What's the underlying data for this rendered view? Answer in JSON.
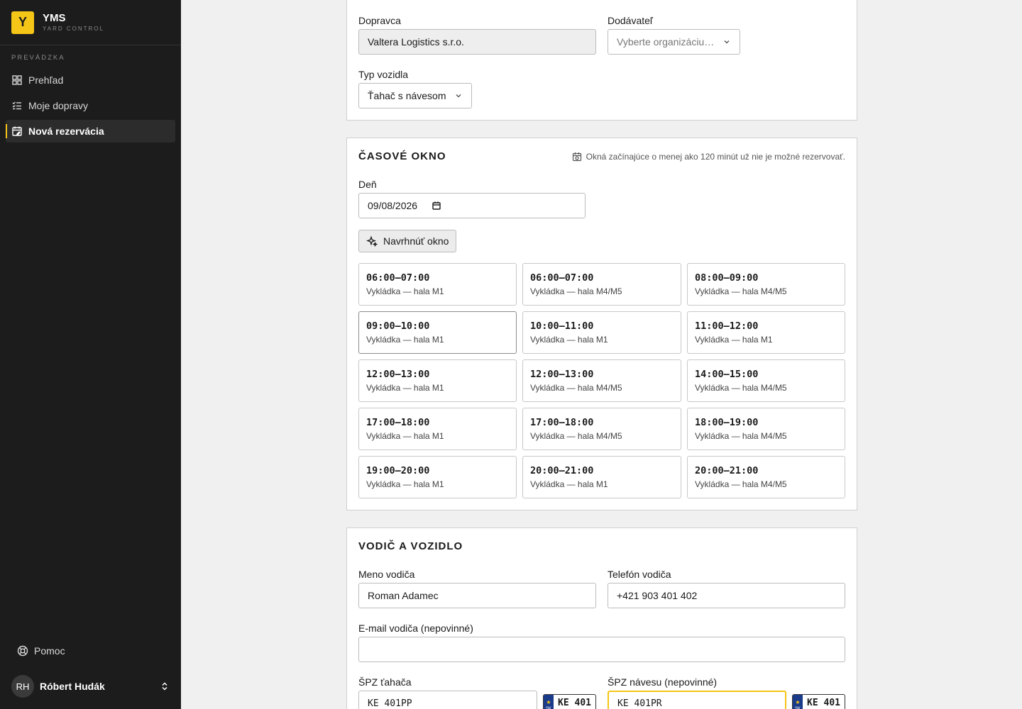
{
  "brand": {
    "logo_letter": "Y",
    "name": "YMS",
    "subtitle": "YARD CONTROL",
    "accent": "#f5c518"
  },
  "sidebar": {
    "section": "PREVÁDZKA",
    "items": [
      {
        "label": "Prehľad",
        "icon": "grid-icon"
      },
      {
        "label": "Moje dopravy",
        "icon": "list-check-icon"
      },
      {
        "label": "Nová rezervácia",
        "icon": "calendar-edit-icon",
        "active": true
      }
    ],
    "help": "Pomoc",
    "user": {
      "initials": "RH",
      "name": "Róbert Hudák"
    }
  },
  "carrier_card": {
    "carrier_label": "Dopravca",
    "carrier_value": "Valtera Logistics s.r.o.",
    "supplier_label": "Dodávateľ",
    "supplier_placeholder": "Vyberte organizáciu…",
    "vehicle_type_label": "Typ vozidla",
    "vehicle_type_value": "Ťahač s návesom"
  },
  "time_card": {
    "title": "Časové okno",
    "hint": "Okná začínajúce o menej ako 120 minút už nie je možné rezervovať.",
    "day_label": "Deň",
    "day_value": "09/08/2026",
    "suggest_button": "Navrhnúť okno",
    "slots": [
      {
        "time": "06:00–07:00",
        "sub": "Vykládka — hala M1"
      },
      {
        "time": "06:00–07:00",
        "sub": "Vykládka — hala M4/M5"
      },
      {
        "time": "08:00–09:00",
        "sub": "Vykládka — hala M4/M5"
      },
      {
        "time": "09:00–10:00",
        "sub": "Vykládka — hala M1"
      },
      {
        "time": "10:00–11:00",
        "sub": "Vykládka — hala M1"
      },
      {
        "time": "11:00–12:00",
        "sub": "Vykládka — hala M1"
      },
      {
        "time": "12:00–13:00",
        "sub": "Vykládka — hala M1"
      },
      {
        "time": "12:00–13:00",
        "sub": "Vykládka — hala M4/M5"
      },
      {
        "time": "14:00–15:00",
        "sub": "Vykládka — hala M4/M5"
      },
      {
        "time": "17:00–18:00",
        "sub": "Vykládka — hala M1"
      },
      {
        "time": "17:00–18:00",
        "sub": "Vykládka — hala M4/M5"
      },
      {
        "time": "18:00–19:00",
        "sub": "Vykládka — hala M4/M5"
      },
      {
        "time": "19:00–20:00",
        "sub": "Vykládka — hala M1"
      },
      {
        "time": "20:00–21:00",
        "sub": "Vykládka — hala M1"
      },
      {
        "time": "20:00–21:00",
        "sub": "Vykládka — hala M4/M5"
      }
    ]
  },
  "driver_card": {
    "title": "Vodič a vozidlo",
    "driver_name_label": "Meno vodiča",
    "driver_name_value": "Roman Adamec",
    "driver_phone_label": "Telefón vodiča",
    "driver_phone_value": "+421 903 401 402",
    "driver_email_label": "E-mail vodiča (nepovinné)",
    "driver_email_value": "",
    "tractor_plate_label": "ŠPZ ťahača",
    "tractor_plate_value": "KE 401PP",
    "tractor_plate_preview": "KE 401",
    "trailer_plate_label": "ŠPZ návesu (nepovinné)",
    "trailer_plate_value": "KE 401PR",
    "trailer_plate_preview": "KE 401",
    "plate_country": "SK"
  }
}
